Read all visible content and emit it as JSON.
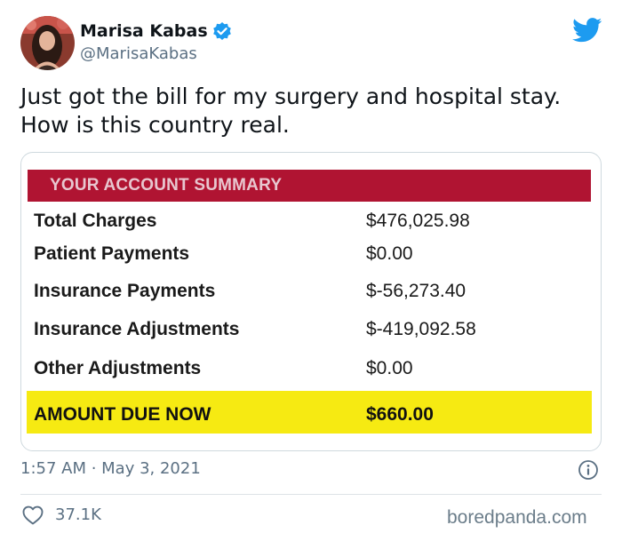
{
  "author": {
    "name": "Marisa Kabas",
    "handle": "@MarisaKabas",
    "verified": true
  },
  "tweet": {
    "text_line1": "Just got the bill for my surgery and hospital stay.",
    "text_line2": "How is this country real.",
    "timestamp": "1:57 AM · May 3, 2021",
    "likes": "37.1K"
  },
  "bill": {
    "header": "YOUR ACCOUNT SUMMARY",
    "rows": [
      {
        "label": "Total Charges",
        "value": "$476,025.98"
      },
      {
        "label": "Patient Payments",
        "value": "$0.00"
      },
      {
        "label": "Insurance Payments",
        "value": "$-56,273.40"
      },
      {
        "label": "Insurance Adjustments",
        "value": "$-419,092.58"
      },
      {
        "label": "Other Adjustments",
        "value": "$0.00"
      }
    ],
    "due_label": "AMOUNT DUE NOW",
    "due_value": "$660.00"
  },
  "watermark": "boredpanda.com",
  "icons": {
    "brand": "twitter-bird-icon",
    "verified": "verified-badge-icon",
    "info": "info-icon",
    "like": "heart-icon"
  },
  "colors": {
    "twitter_blue": "#1d9bf0",
    "bill_header_red": "#b01432",
    "amount_due_yellow": "#f6ea12",
    "secondary_text": "#5b7083"
  }
}
